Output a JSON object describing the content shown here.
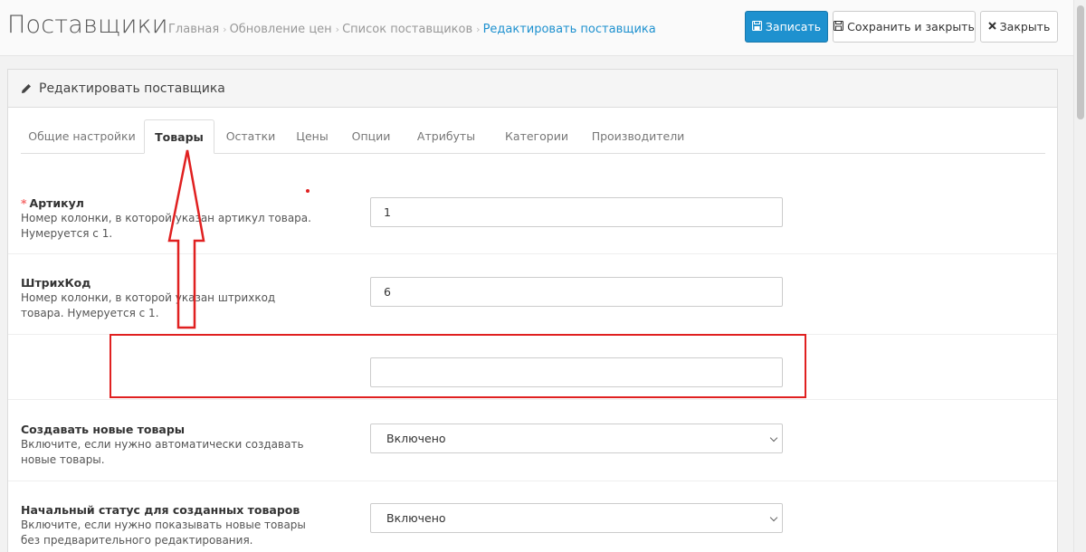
{
  "header": {
    "title": "Поставщики",
    "breadcrumbs": [
      "Главная",
      "Обновление цен",
      "Список поставщиков",
      "Редактировать поставщика"
    ],
    "breadcrumb_separator": "›",
    "buttons": {
      "save": "Записать",
      "save_close": "Сохранить и закрыть",
      "close": "Закрыть"
    }
  },
  "panel": {
    "title": "Редактировать поставщика"
  },
  "tabs": [
    {
      "label": "Общие настройки",
      "active": false
    },
    {
      "label": "Товары",
      "active": true
    },
    {
      "label": "Остатки",
      "active": false
    },
    {
      "label": "Цены",
      "active": false
    },
    {
      "label": "Опции",
      "active": false
    },
    {
      "label": "Атрибуты",
      "active": false
    },
    {
      "label": "Категории",
      "active": false
    },
    {
      "label": "Производители",
      "active": false
    }
  ],
  "fields": [
    {
      "label": "Артикул",
      "required": true,
      "required_mark": "*",
      "help": "Номер колонки, в которой указан артикул товара. Нумеруется с 1.",
      "value": "1"
    },
    {
      "label": "ШтрихКод",
      "required": false,
      "help": "Номер колонки, в которой указан штрихкод товара. Нумеруется с 1.",
      "value": "6"
    },
    {
      "label": "",
      "help": "",
      "value": ""
    },
    {
      "label": "Создавать новые товары",
      "help": "Включите, если нужно автоматически создавать новые товары.",
      "value": "Включено"
    },
    {
      "label": "Начальный статус для созданных товаров",
      "help": "Включите, если нужно показывать новые товары без предварительного редактирования.",
      "value": "Включено"
    }
  ],
  "colors": {
    "primary": "#1e91cf",
    "annotation_red": "#e02020",
    "required_star": "#f56b6b"
  }
}
